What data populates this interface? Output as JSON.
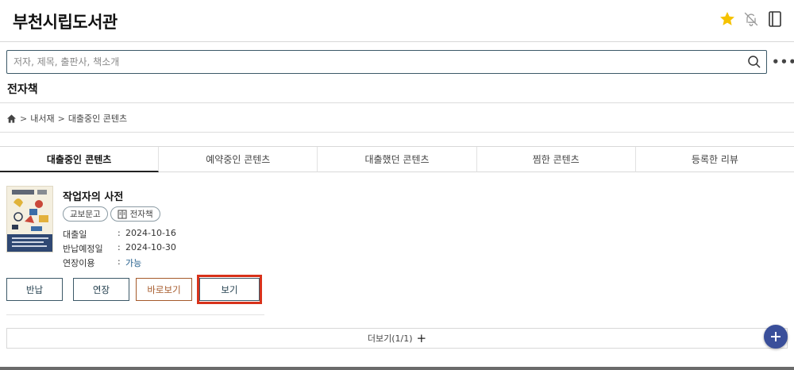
{
  "header": {
    "title": "부천시립도서관",
    "icons": [
      "star-icon",
      "bell-off-icon",
      "book-icon"
    ],
    "star_color": "#f5c200"
  },
  "search": {
    "placeholder": "저자, 제목, 출판사, 책소개",
    "value": ""
  },
  "section": {
    "title": "전자책"
  },
  "breadcrumb": {
    "items": [
      "내서재",
      "대출중인 콘텐츠"
    ]
  },
  "tabs": [
    {
      "label": "대출중인 콘텐츠",
      "active": true
    },
    {
      "label": "예약중인 콘텐츠",
      "active": false
    },
    {
      "label": "대출했던 콘텐츠",
      "active": false
    },
    {
      "label": "찜한 콘텐츠",
      "active": false
    },
    {
      "label": "등록한 리뷰",
      "active": false
    }
  ],
  "book": {
    "title": "작업자의 사전",
    "badges": {
      "provider": "교보문고",
      "type": "전자책"
    },
    "details": [
      {
        "label": "대출일",
        "value": "2024-10-16"
      },
      {
        "label": "반납예정일",
        "value": "2024-10-30"
      },
      {
        "label": "연장이용",
        "value": "가능"
      }
    ],
    "buttons": {
      "return": "반납",
      "extend": "연장",
      "quick_view": "바로보기",
      "view": "보기"
    }
  },
  "more": {
    "label": "더보기(1/1)"
  },
  "colors": {
    "accent": "#3c5968",
    "brown": "#a55a2b",
    "highlight": "#d8321b",
    "fab": "#3a4f9a"
  }
}
